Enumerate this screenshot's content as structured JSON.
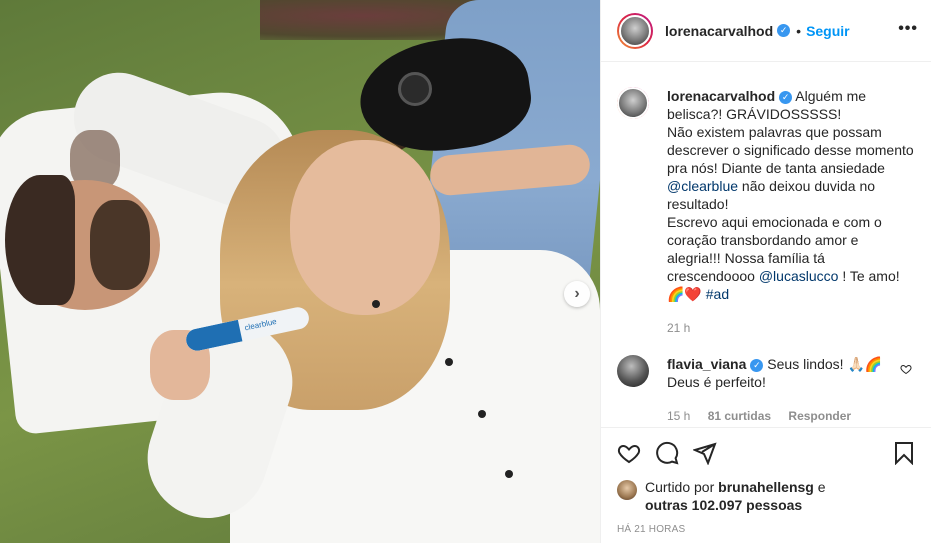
{
  "post": {
    "image_alt": "",
    "test_label": "clearblue",
    "next_glyph": "›"
  },
  "header": {
    "username": "lorenacarvalhod",
    "verified_glyph": "✓",
    "separator": "•",
    "follow_label": "Seguir",
    "more_label": "•••"
  },
  "caption": {
    "username": "lorenacarvalhod",
    "text_1": "Alguém me belisca?! GRÁVIDOSSSSS!",
    "text_2": "Não existem palavras que possam descrever o significado desse momento pra nós! Diante de tanta ansiedade",
    "mention_1": "@clearblue",
    "text_3": "não deixou duvida no resultado!",
    "text_4": "Escrevo aqui emocionada e com o coração transbordando amor e alegria!!! Nossa família tá crescendoooo",
    "mention_2": "@lucaslucco",
    "text_5": "! Te amo!",
    "emoji": "🌈❤️",
    "hashtag": "#ad",
    "time": "21 h"
  },
  "comment": {
    "username": "flavia_viana",
    "text_1": "Seus lindos! 🙏🏻🌈",
    "text_2": "Deus é perfeito!",
    "time": "15 h",
    "likes": "81 curtidas",
    "reply_label": "Responder"
  },
  "likes": {
    "prefix": "Curtido por",
    "user": "brunahellensg",
    "and": "e",
    "others": "outras 102.097 pessoas"
  },
  "timestamp": "HÁ 21 HORAS",
  "icons": {
    "like": "heart-icon",
    "comment": "comment-icon",
    "share": "share-icon",
    "save": "bookmark-icon",
    "comment_like": "heart-icon"
  },
  "colors": {
    "link": "#0095f6",
    "mention": "#00376b",
    "verified": "#3897f0",
    "muted": "#8e8e8e"
  }
}
